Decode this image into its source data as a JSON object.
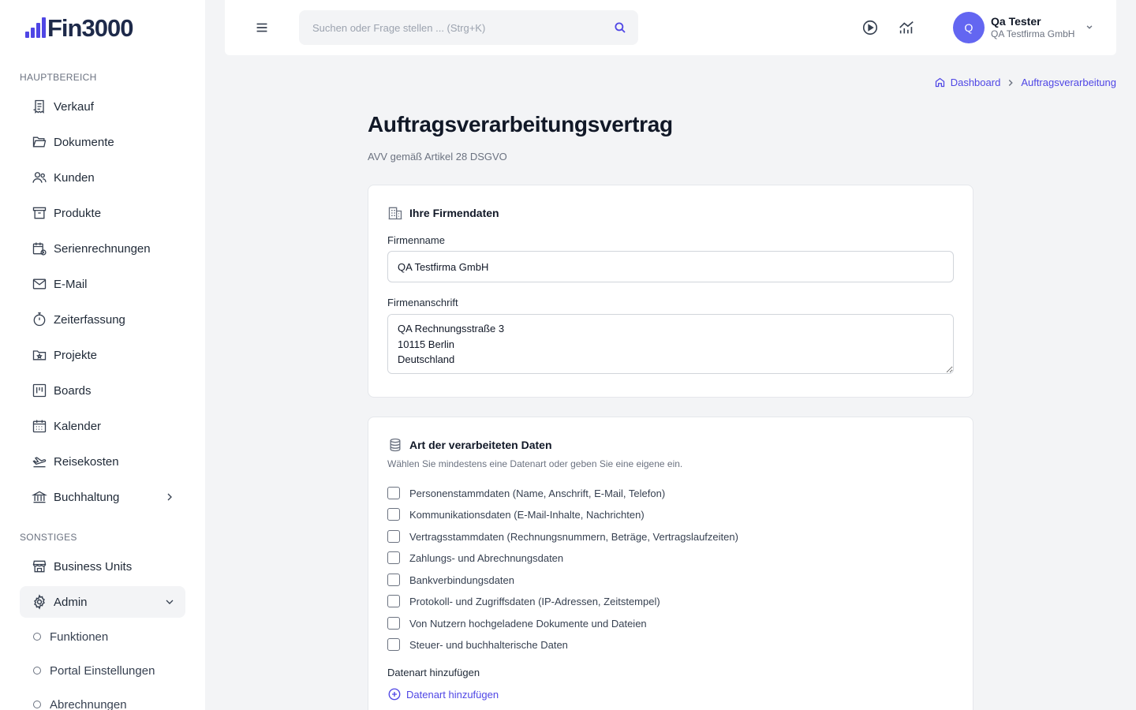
{
  "app": {
    "logo_text": "Fin3000"
  },
  "sidebar": {
    "section_main": "HAUPTBEREICH",
    "main_items": [
      {
        "label": "Verkauf",
        "icon": "receipt-icon"
      },
      {
        "label": "Dokumente",
        "icon": "folder-open-icon"
      },
      {
        "label": "Kunden",
        "icon": "users-icon"
      },
      {
        "label": "Produkte",
        "icon": "archive-box-icon"
      },
      {
        "label": "Serienrechnungen",
        "icon": "calendar-repeat-icon"
      },
      {
        "label": "E-Mail",
        "icon": "envelope-icon"
      },
      {
        "label": "Zeiterfassung",
        "icon": "stopwatch-icon"
      },
      {
        "label": "Projekte",
        "icon": "folder-star-icon"
      },
      {
        "label": "Boards",
        "icon": "kanban-icon"
      },
      {
        "label": "Kalender",
        "icon": "calendar-icon"
      },
      {
        "label": "Reisekosten",
        "icon": "plane-departure-icon"
      },
      {
        "label": "Buchhaltung",
        "icon": "bank-icon"
      }
    ],
    "section_other": "SONSTIGES",
    "other_items": [
      {
        "label": "Business Units",
        "icon": "storefront-icon"
      },
      {
        "label": "Admin",
        "icon": "gear-icon"
      }
    ],
    "admin_sub_items": [
      {
        "label": "Funktionen"
      },
      {
        "label": "Portal Einstellungen"
      },
      {
        "label": "Abrechnungen"
      }
    ]
  },
  "topbar": {
    "search_placeholder": "Suchen oder Frage stellen ... (Strg+K)",
    "user": {
      "initial": "Q",
      "name": "Qa Tester",
      "company": "QA Testfirma GmbH"
    }
  },
  "breadcrumb": {
    "home": "Dashboard",
    "current": "Auftragsverarbeitung"
  },
  "page": {
    "title": "Auftragsverarbeitungsvertrag",
    "subtitle": "AVV gemäß Artikel 28 DSGVO"
  },
  "company_card": {
    "title": "Ihre Firmendaten",
    "name_label": "Firmenname",
    "name_value": "QA Testfirma GmbH",
    "address_label": "Firmenanschrift",
    "address_value": "QA Rechnungsstraße 3\n10115 Berlin\nDeutschland"
  },
  "data_card": {
    "title": "Art der verarbeiteten Daten",
    "hint": "Wählen Sie mindestens eine Datenart oder geben Sie eine eigene ein.",
    "options": [
      {
        "label": "Personenstammdaten (Name, Anschrift, E-Mail, Telefon)",
        "checked": false
      },
      {
        "label": "Kommunikationsdaten (E-Mail-Inhalte, Nachrichten)",
        "checked": false
      },
      {
        "label": "Vertragsstammdaten (Rechnungsnummern, Beträge, Vertragslaufzeiten)",
        "checked": false
      },
      {
        "label": "Zahlungs- und Abrechnungsdaten",
        "checked": false
      },
      {
        "label": "Bankverbindungsdaten",
        "checked": false
      },
      {
        "label": "Protokoll- und Zugriffsdaten (IP-Adressen, Zeitstempel)",
        "checked": false
      },
      {
        "label": "Von Nutzern hochgeladene Dokumente und Dateien",
        "checked": false
      },
      {
        "label": "Steuer- und buchhalterische Daten",
        "checked": false
      }
    ],
    "add_label": "Datenart hinzufügen",
    "add_link": "Datenart hinzufügen"
  },
  "colors": {
    "accent": "#4f46e5",
    "avatar": "#6366f1",
    "background": "#f3f4f6"
  }
}
